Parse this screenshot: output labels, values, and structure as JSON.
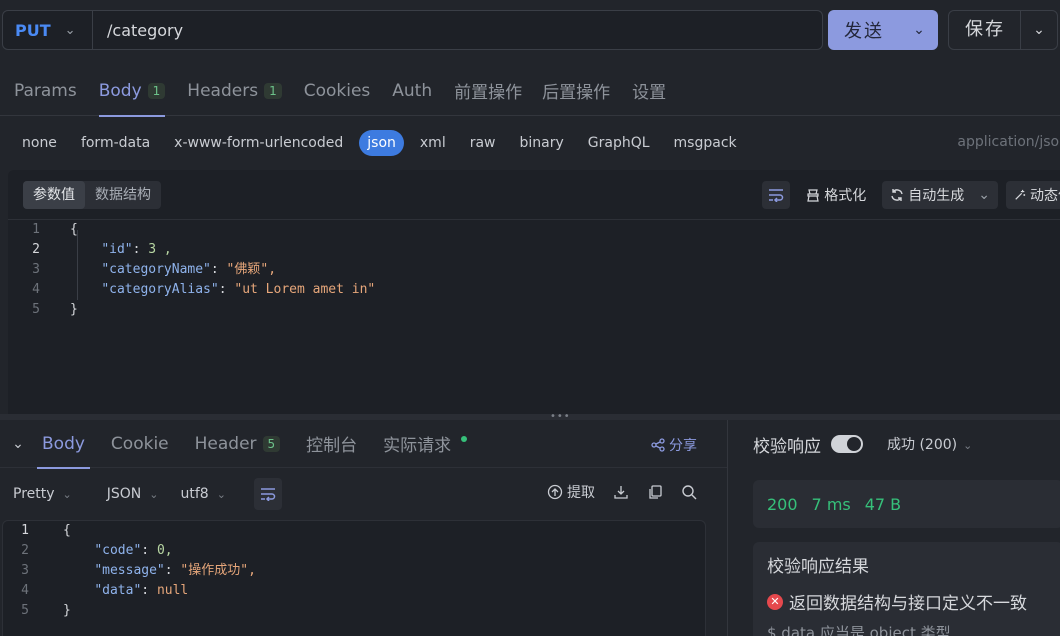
{
  "request": {
    "method": "PUT",
    "url": "/category",
    "send_label": "发送",
    "save_label": "保存"
  },
  "req_tabs": [
    {
      "label": "Params",
      "badge": ""
    },
    {
      "label": "Body",
      "badge": "1"
    },
    {
      "label": "Headers",
      "badge": "1"
    },
    {
      "label": "Cookies",
      "badge": ""
    },
    {
      "label": "Auth",
      "badge": ""
    },
    {
      "label": "前置操作",
      "badge": ""
    },
    {
      "label": "后置操作",
      "badge": ""
    },
    {
      "label": "设置",
      "badge": ""
    }
  ],
  "body_types": [
    "none",
    "form-data",
    "x-www-form-urlencoded",
    "json",
    "xml",
    "raw",
    "binary",
    "GraphQL",
    "msgpack"
  ],
  "content_type": "application/json",
  "editor": {
    "seg_values": "参数值",
    "seg_schema": "数据结构",
    "format_label": "格式化",
    "autogen_label": "自动生成",
    "dynamic_label": "动态值",
    "lines": [
      {
        "n": "1",
        "indent": "",
        "key": "",
        "sep": "",
        "val": "{",
        "type": "brace"
      },
      {
        "n": "2",
        "indent": "    ",
        "key": "\"id\"",
        "sep": ": ",
        "val": "3 ,",
        "type": "num"
      },
      {
        "n": "3",
        "indent": "    ",
        "key": "\"categoryName\"",
        "sep": ": ",
        "val": "\"佛颖\",",
        "type": "str"
      },
      {
        "n": "4",
        "indent": "    ",
        "key": "\"categoryAlias\"",
        "sep": ": ",
        "val": "\"ut Lorem amet in\"",
        "type": "str"
      },
      {
        "n": "5",
        "indent": "",
        "key": "",
        "sep": "",
        "val": "}",
        "type": "brace"
      }
    ]
  },
  "response": {
    "tabs": [
      {
        "label": "Body",
        "badge": ""
      },
      {
        "label": "Cookie",
        "badge": ""
      },
      {
        "label": "Header",
        "badge": "5"
      },
      {
        "label": "控制台",
        "badge": ""
      },
      {
        "label": "实际请求",
        "badge": ""
      }
    ],
    "share_label": "分享",
    "format": "Pretty",
    "lang": "JSON",
    "encoding": "utf8",
    "extract_label": "提取",
    "lines": [
      {
        "n": "1",
        "indent": "",
        "key": "",
        "sep": "",
        "val": "{",
        "type": "brace"
      },
      {
        "n": "2",
        "indent": "    ",
        "key": "\"code\"",
        "sep": ": ",
        "val": "0,",
        "type": "num"
      },
      {
        "n": "3",
        "indent": "    ",
        "key": "\"message\"",
        "sep": ": ",
        "val": "\"操作成功\",",
        "type": "str"
      },
      {
        "n": "4",
        "indent": "    ",
        "key": "\"data\"",
        "sep": ": ",
        "val": "null",
        "type": "kw"
      },
      {
        "n": "5",
        "indent": "",
        "key": "",
        "sep": "",
        "val": "}",
        "type": "brace"
      }
    ]
  },
  "verify": {
    "title": "校验响应",
    "status": "成功 (200)",
    "code": "200",
    "time": "7 ms",
    "size": "47 B",
    "result_title": "校验响应结果",
    "error": "返回数据结构与接口定义不一致",
    "detail": "$.data 应当是 object 类型"
  },
  "colors": {
    "accent": "#8c9adf",
    "method": "#4a8af4",
    "success": "#36c07a",
    "error": "#e5484d",
    "json_active": "#3d7be0"
  }
}
